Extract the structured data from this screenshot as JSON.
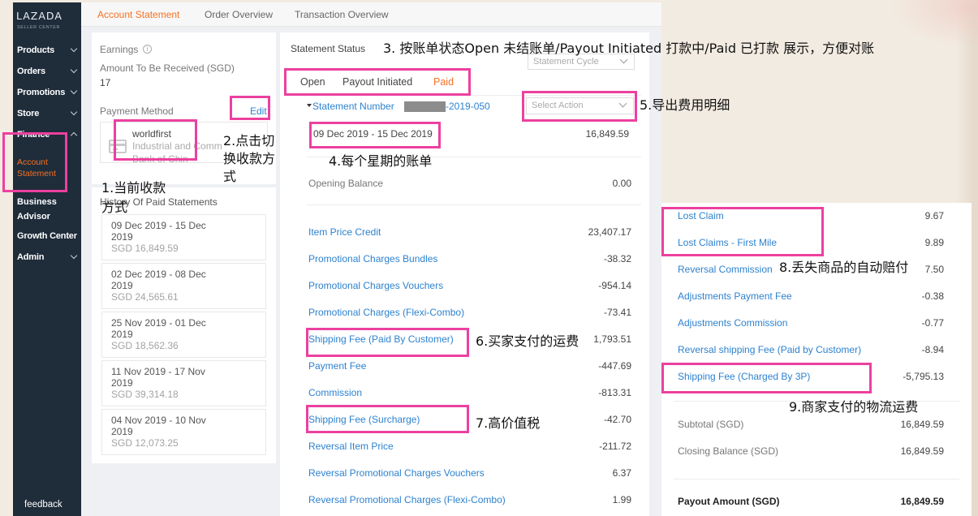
{
  "theme": {
    "accent": "#f57224",
    "link": "#2d82cf",
    "annotation": "#ec409f",
    "sidebar": "#1f2c3a"
  },
  "sidebar": {
    "logo": "LAZADA",
    "logo_sub": "SELLER CENTER",
    "products": "Products",
    "orders": "Orders",
    "promotions": "Promotions",
    "store": "Store",
    "finance": "Finance",
    "account_statement": "Account Statement",
    "business_advisor": "Business Advisor",
    "growth_center": "Growth Center",
    "admin": "Admin",
    "feedback": "feedback",
    "chevron_icon": "chevron-down-icon",
    "expanded_icon": "chevron-up-icon"
  },
  "topnav": {
    "tabs": [
      {
        "label": "Account Statement",
        "active": true
      },
      {
        "label": "Order Overview"
      },
      {
        "label": "Transaction Overview"
      }
    ]
  },
  "earnings": {
    "title": "Earnings",
    "info_icon": "info-icon",
    "amount_label": "Amount To Be Received (SGD)",
    "amount_value": "17",
    "payment_method_label": "Payment Method",
    "edit_label": "Edit",
    "payment": {
      "icon": "bank-card-icon",
      "name": "worldfirst",
      "line1": "Industrial and Comm",
      "line2": "Bank of Chin"
    }
  },
  "history": {
    "title": "History Of Paid Statements",
    "items": [
      {
        "range": "09 Dec 2019 - 15 Dec",
        "year": "2019",
        "amount": "SGD 16,849.59"
      },
      {
        "range": "02 Dec 2019 - 08 Dec",
        "year": "2019",
        "amount": "SGD 24,565.61"
      },
      {
        "range": "25 Nov 2019 - 01 Dec",
        "year": "2019",
        "amount": "SGD 18,562.36"
      },
      {
        "range": "11 Nov 2019 - 17 Nov",
        "year": "2019",
        "amount": "SGD 39,314.18"
      },
      {
        "range": "04 Nov 2019 - 10 Nov",
        "year": "2019",
        "amount": "SGD 12,073.25"
      }
    ]
  },
  "statement": {
    "status_label": "Statement Status",
    "cycle_placeholder": "Statement Cycle",
    "tabs": [
      {
        "label": "Open"
      },
      {
        "label": "Payout Initiated"
      },
      {
        "label": "Paid",
        "active": true
      }
    ],
    "number_label": "Statement Number",
    "number_suffix": "-2019-050",
    "action_placeholder": "Select Action",
    "period": "09 Dec 2019 - 15 Dec 2019",
    "period_total": "16,849.59",
    "opening_balance_label": "Opening Balance",
    "opening_balance": "0.00",
    "rows": [
      {
        "label": "Item Price Credit",
        "value": "23,407.17"
      },
      {
        "label": "Promotional Charges Bundles",
        "value": "-38.32"
      },
      {
        "label": "Promotional Charges Vouchers",
        "value": "-954.14"
      },
      {
        "label": "Promotional Charges (Flexi-Combo)",
        "value": "-73.41"
      },
      {
        "label": "Shipping Fee (Paid By Customer)",
        "value": "1,793.51"
      },
      {
        "label": "Payment Fee",
        "value": "-447.69"
      },
      {
        "label": "Commission",
        "value": "-813.31"
      },
      {
        "label": "Shipping Fee (Surcharge)",
        "value": "-42.70"
      },
      {
        "label": "Reversal Item Price",
        "value": "-211.72"
      },
      {
        "label": "Reversal Promotional Charges Vouchers",
        "value": "6.37"
      },
      {
        "label": "Reversal Promotional Charges (Flexi-Combo)",
        "value": "1.99"
      }
    ]
  },
  "breakdown": {
    "rows": [
      {
        "label": "Lost Claim",
        "value": "9.67"
      },
      {
        "label": "Lost Claims - First Mile",
        "value": "9.89"
      },
      {
        "label": "Reversal Commission",
        "value": "7.50"
      },
      {
        "label": "Adjustments Payment Fee",
        "value": "-0.38"
      },
      {
        "label": "Adjustments Commission",
        "value": "-0.77"
      },
      {
        "label": "Reversal shipping Fee (Paid by Customer)",
        "value": "-8.94"
      },
      {
        "label": "Shipping Fee (Charged By 3P)",
        "value": "-5,795.13"
      }
    ],
    "subtotal_label": "Subtotal (SGD)",
    "subtotal": "16,849.59",
    "closing_label": "Closing Balance (SGD)",
    "closing": "16,849.59",
    "payout_label": "Payout Amount (SGD)",
    "payout": "16,849.59"
  },
  "annotations": {
    "a1": [
      "1.当前收款",
      "方式"
    ],
    "a2": [
      "2.点击切",
      "换收款方",
      "式"
    ],
    "a3": "3. 按账单状态Open 未结账单/Payout Initiated 打款中/Paid 已打款 展示，方便对账",
    "a4": "4.每个星期的账单",
    "a5": "5.导出费用明细",
    "a6": "6.买家支付的运费",
    "a7": "7.高价值税",
    "a8": "8.丢失商品的自动赔付",
    "a9": "9.商家支付的物流运费"
  }
}
